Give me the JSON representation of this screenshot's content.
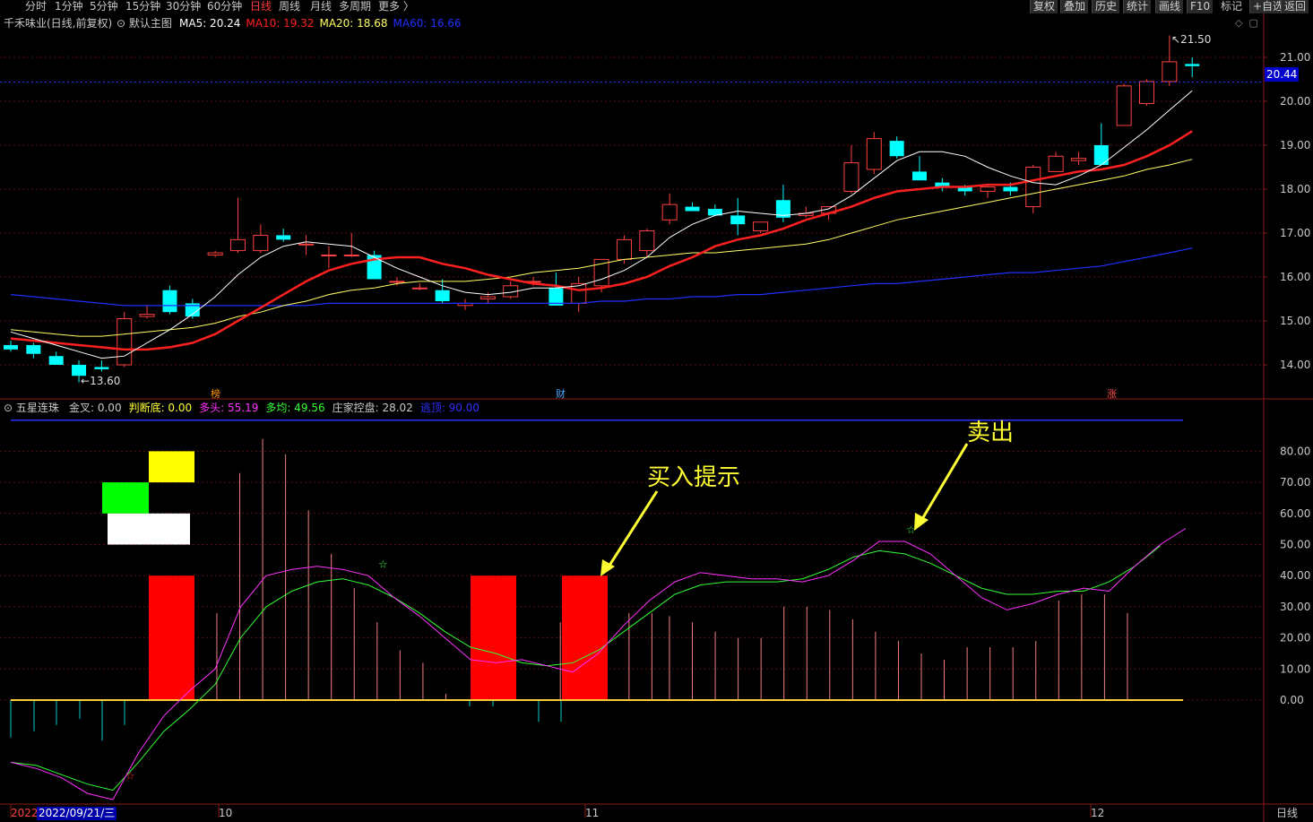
{
  "toolbar": {
    "periods": [
      "分时",
      "1分钟",
      "5分钟",
      "15分钟",
      "30分钟",
      "60分钟",
      "日线",
      "周线",
      "月线",
      "多周期",
      "更多 〉"
    ],
    "active_period": "日线",
    "right_buttons": [
      "复权",
      "叠加",
      "历史",
      "统计",
      "画线",
      "F10",
      "+自选",
      "返回"
    ],
    "marks_label": "标记"
  },
  "main_chart": {
    "stock_name": "千禾味业(日线,前复权)",
    "indicator_label": "默认主图",
    "ma": [
      {
        "label": "MA5: 20.24",
        "color": "#ffffff"
      },
      {
        "label": "MA10: 19.32",
        "color": "#ff2020"
      },
      {
        "label": "MA20: 18.68",
        "color": "#ffff66"
      },
      {
        "label": "MA60: 16.66",
        "color": "#2030ff"
      }
    ],
    "current_price": "20.44",
    "high_label": "21.50",
    "low_label": "13.60",
    "event_marks": [
      "榜",
      "财",
      "涨"
    ]
  },
  "sub_chart": {
    "name": "五星连珠",
    "values": [
      {
        "label": "金叉: 0.00",
        "color": "#c8c8c8"
      },
      {
        "label": "判断底: 0.00",
        "color": "#ffff33"
      },
      {
        "label": "多头: 55.19",
        "color": "#ff33ff"
      },
      {
        "label": "多均: 49.56",
        "color": "#33ff33"
      },
      {
        "label": "庄家控盘: 28.02",
        "color": "#c8c8c8"
      },
      {
        "label": "逃顶: 90.00",
        "color": "#3030ff"
      }
    ]
  },
  "annotations": {
    "buy": "买入提示",
    "sell": "卖出"
  },
  "x_axis": {
    "year": "2022",
    "cursor_date": "2022/09/21/三",
    "months": [
      "10",
      "11",
      "12"
    ],
    "period_label": "日线"
  },
  "chart_data": [
    {
      "type": "candlestick",
      "title": "千禾味业(日线,前复权)",
      "y_ticks": [
        "14.00",
        "15.00",
        "16.00",
        "17.00",
        "18.00",
        "19.00",
        "20.00",
        "21.00"
      ],
      "ylim": [
        13.2,
        21.9
      ],
      "ohlc": [
        [
          14.45,
          14.55,
          14.3,
          14.35
        ],
        [
          14.45,
          14.5,
          14.15,
          14.25
        ],
        [
          14.2,
          14.3,
          14.0,
          14.0
        ],
        [
          14.0,
          14.1,
          13.6,
          13.75
        ],
        [
          13.95,
          14.1,
          13.85,
          13.9
        ],
        [
          14.0,
          15.2,
          13.95,
          15.05
        ],
        [
          15.1,
          15.35,
          15.05,
          15.15
        ],
        [
          15.7,
          15.8,
          15.15,
          15.2
        ],
        [
          15.4,
          15.5,
          15.05,
          15.1
        ],
        [
          16.5,
          16.6,
          16.45,
          16.55
        ],
        [
          16.6,
          17.8,
          16.55,
          16.85
        ],
        [
          16.6,
          17.2,
          16.55,
          16.95
        ],
        [
          16.95,
          17.1,
          16.8,
          16.85
        ],
        [
          16.75,
          16.95,
          16.5,
          16.75
        ],
        [
          16.5,
          16.7,
          16.2,
          16.5
        ],
        [
          16.5,
          17.0,
          16.45,
          16.5
        ],
        [
          16.5,
          16.6,
          15.95,
          15.95
        ],
        [
          15.9,
          16.0,
          15.8,
          15.9
        ],
        [
          15.75,
          15.85,
          15.7,
          15.75
        ],
        [
          15.7,
          15.95,
          15.4,
          15.45
        ],
        [
          15.35,
          15.5,
          15.25,
          15.4
        ],
        [
          15.5,
          15.65,
          15.4,
          15.55
        ],
        [
          15.55,
          15.9,
          15.5,
          15.8
        ],
        [
          15.9,
          16.0,
          15.8,
          15.9
        ],
        [
          15.75,
          16.1,
          15.35,
          15.35
        ],
        [
          15.4,
          16.0,
          15.2,
          15.85
        ],
        [
          15.8,
          16.4,
          15.65,
          16.4
        ],
        [
          16.4,
          16.95,
          16.3,
          16.85
        ],
        [
          16.6,
          17.1,
          16.45,
          17.05
        ],
        [
          17.3,
          17.9,
          17.2,
          17.65
        ],
        [
          17.6,
          17.7,
          17.5,
          17.5
        ],
        [
          17.55,
          17.65,
          17.4,
          17.4
        ],
        [
          17.4,
          17.8,
          16.95,
          17.2
        ],
        [
          17.05,
          17.25,
          17.0,
          17.25
        ],
        [
          17.75,
          18.1,
          17.25,
          17.35
        ],
        [
          17.4,
          17.6,
          17.35,
          17.45
        ],
        [
          17.45,
          17.5,
          17.3,
          17.6
        ],
        [
          17.95,
          19.0,
          17.9,
          18.6
        ],
        [
          18.45,
          19.3,
          18.35,
          19.15
        ],
        [
          19.1,
          19.2,
          18.7,
          18.75
        ],
        [
          18.4,
          18.75,
          18.2,
          18.2
        ],
        [
          18.15,
          18.25,
          17.95,
          18.05
        ],
        [
          18.05,
          18.1,
          17.85,
          17.95
        ],
        [
          17.95,
          18.1,
          17.8,
          18.05
        ],
        [
          18.05,
          18.15,
          17.85,
          17.95
        ],
        [
          17.6,
          18.55,
          17.45,
          18.5
        ],
        [
          18.4,
          18.85,
          18.4,
          18.75
        ],
        [
          18.65,
          18.85,
          18.55,
          18.7
        ],
        [
          19.0,
          19.5,
          18.7,
          18.55
        ],
        [
          19.45,
          20.4,
          19.45,
          20.35
        ],
        [
          19.95,
          20.5,
          19.9,
          20.45
        ],
        [
          20.45,
          21.5,
          20.35,
          20.9
        ],
        [
          20.85,
          21.0,
          20.55,
          20.8
        ]
      ],
      "ma5": [
        14.75,
        14.6,
        14.45,
        14.3,
        14.15,
        14.2,
        14.5,
        14.8,
        15.15,
        15.55,
        16.05,
        16.45,
        16.7,
        16.8,
        16.75,
        16.7,
        16.45,
        16.2,
        16.0,
        15.8,
        15.65,
        15.6,
        15.65,
        15.75,
        15.75,
        15.8,
        15.95,
        16.15,
        16.45,
        16.9,
        17.2,
        17.4,
        17.5,
        17.45,
        17.4,
        17.45,
        17.55,
        17.85,
        18.25,
        18.65,
        18.85,
        18.85,
        18.75,
        18.5,
        18.3,
        18.15,
        18.1,
        18.3,
        18.55,
        18.95,
        19.35,
        19.8,
        20.24
      ],
      "ma10": [
        14.6,
        14.55,
        14.5,
        14.45,
        14.4,
        14.35,
        14.35,
        14.4,
        14.5,
        14.7,
        15.0,
        15.3,
        15.6,
        15.9,
        16.15,
        16.3,
        16.4,
        16.45,
        16.45,
        16.3,
        16.2,
        16.05,
        15.95,
        15.85,
        15.8,
        15.7,
        15.75,
        15.85,
        16.0,
        16.25,
        16.45,
        16.7,
        16.85,
        16.95,
        17.1,
        17.3,
        17.45,
        17.6,
        17.8,
        17.95,
        18.0,
        18.05,
        18.05,
        18.1,
        18.1,
        18.2,
        18.3,
        18.4,
        18.45,
        18.55,
        18.75,
        19.0,
        19.32
      ],
      "ma20": [
        14.8,
        14.75,
        14.7,
        14.65,
        14.65,
        14.7,
        14.75,
        14.8,
        14.85,
        14.95,
        15.1,
        15.2,
        15.35,
        15.45,
        15.6,
        15.7,
        15.75,
        15.85,
        15.9,
        15.9,
        15.9,
        15.95,
        16.0,
        16.1,
        16.15,
        16.2,
        16.3,
        16.4,
        16.45,
        16.5,
        16.55,
        16.55,
        16.6,
        16.65,
        16.7,
        16.75,
        16.85,
        17.0,
        17.15,
        17.3,
        17.4,
        17.5,
        17.6,
        17.7,
        17.8,
        17.9,
        18.0,
        18.1,
        18.2,
        18.3,
        18.45,
        18.55,
        18.68
      ],
      "ma60": [
        15.6,
        15.55,
        15.5,
        15.45,
        15.4,
        15.35,
        15.35,
        15.35,
        15.35,
        15.35,
        15.35,
        15.35,
        15.35,
        15.35,
        15.4,
        15.4,
        15.4,
        15.4,
        15.4,
        15.4,
        15.4,
        15.4,
        15.4,
        15.4,
        15.4,
        15.4,
        15.45,
        15.45,
        15.5,
        15.5,
        15.55,
        15.55,
        15.6,
        15.6,
        15.65,
        15.7,
        15.75,
        15.8,
        15.85,
        15.85,
        15.9,
        15.95,
        16.0,
        16.05,
        16.1,
        16.1,
        16.15,
        16.2,
        16.25,
        16.35,
        16.45,
        16.55,
        16.66
      ]
    },
    {
      "type": "line",
      "title": "五星连珠",
      "y_ticks": [
        "0.00",
        "10.00",
        "20.00",
        "30.00",
        "40.00",
        "50.00",
        "60.00",
        "70.00",
        "80.00"
      ],
      "ylim": [
        -35,
        95
      ],
      "series": [
        {
          "name": "多头",
          "color": "#ff33ff",
          "values": [
            -20,
            -22,
            -25,
            -30,
            -32,
            -17,
            -5,
            3,
            10,
            30,
            40,
            42,
            43,
            42,
            40,
            33,
            27,
            20,
            13,
            12,
            13,
            11,
            9,
            15,
            24,
            32,
            38,
            41,
            40,
            39,
            39,
            38,
            40,
            45,
            51,
            51,
            47,
            40,
            33,
            29,
            31,
            34,
            36,
            35,
            43,
            50,
            55.19
          ]
        },
        {
          "name": "多均",
          "color": "#33ff33",
          "values": [
            -20,
            -21,
            -24,
            -27,
            -29,
            -20,
            -10,
            -3,
            5,
            20,
            30,
            35,
            38,
            39,
            37,
            33,
            28,
            22,
            17,
            15,
            12,
            11,
            12,
            16,
            22,
            28,
            34,
            37,
            38,
            38,
            38,
            39,
            42,
            46,
            48,
            47,
            44,
            40,
            36,
            34,
            34,
            35,
            35,
            38,
            43,
            49.56
          ]
        },
        {
          "name": "庄家控盘",
          "color": "#f08080",
          "values": [
            0,
            0,
            0,
            0,
            0,
            0,
            0,
            0,
            0,
            28,
            73,
            84,
            79,
            61,
            47,
            36,
            25,
            16,
            12,
            2,
            0,
            0,
            0,
            0,
            25,
            28,
            30,
            28,
            28,
            27,
            25,
            22,
            20,
            20,
            30,
            30,
            29,
            26,
            22,
            19,
            15,
            13,
            17,
            17,
            17,
            19,
            32,
            34,
            34,
            28.02
          ]
        },
        {
          "name": "逃顶",
          "color": "#3030ff",
          "values": [
            90,
            90
          ]
        }
      ]
    }
  ]
}
